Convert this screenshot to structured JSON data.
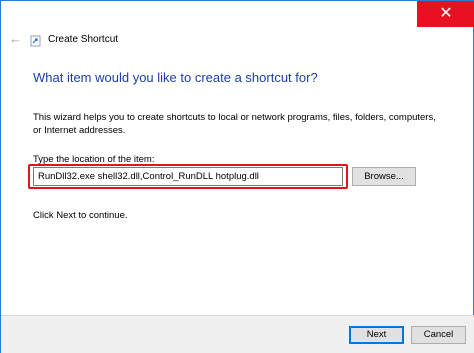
{
  "window": {
    "title": "Create Shortcut",
    "close_symbol": "✕",
    "back_symbol": "←"
  },
  "content": {
    "heading": "What item would you like to create a shortcut for?",
    "description": "This wizard helps you to create shortcuts to local or network programs, files, folders, computers, or Internet addresses.",
    "location_label": "Type the location of the item:",
    "location_value": "RunDll32.exe shell32.dll,Control_RunDLL hotplug.dll",
    "browse_label": "Browse...",
    "continue_text": "Click Next to continue."
  },
  "footer": {
    "next_label": "Next",
    "cancel_label": "Cancel"
  },
  "colors": {
    "heading": "#1d3fa8",
    "highlight": "#e1141e",
    "close_bg": "#e81123"
  }
}
